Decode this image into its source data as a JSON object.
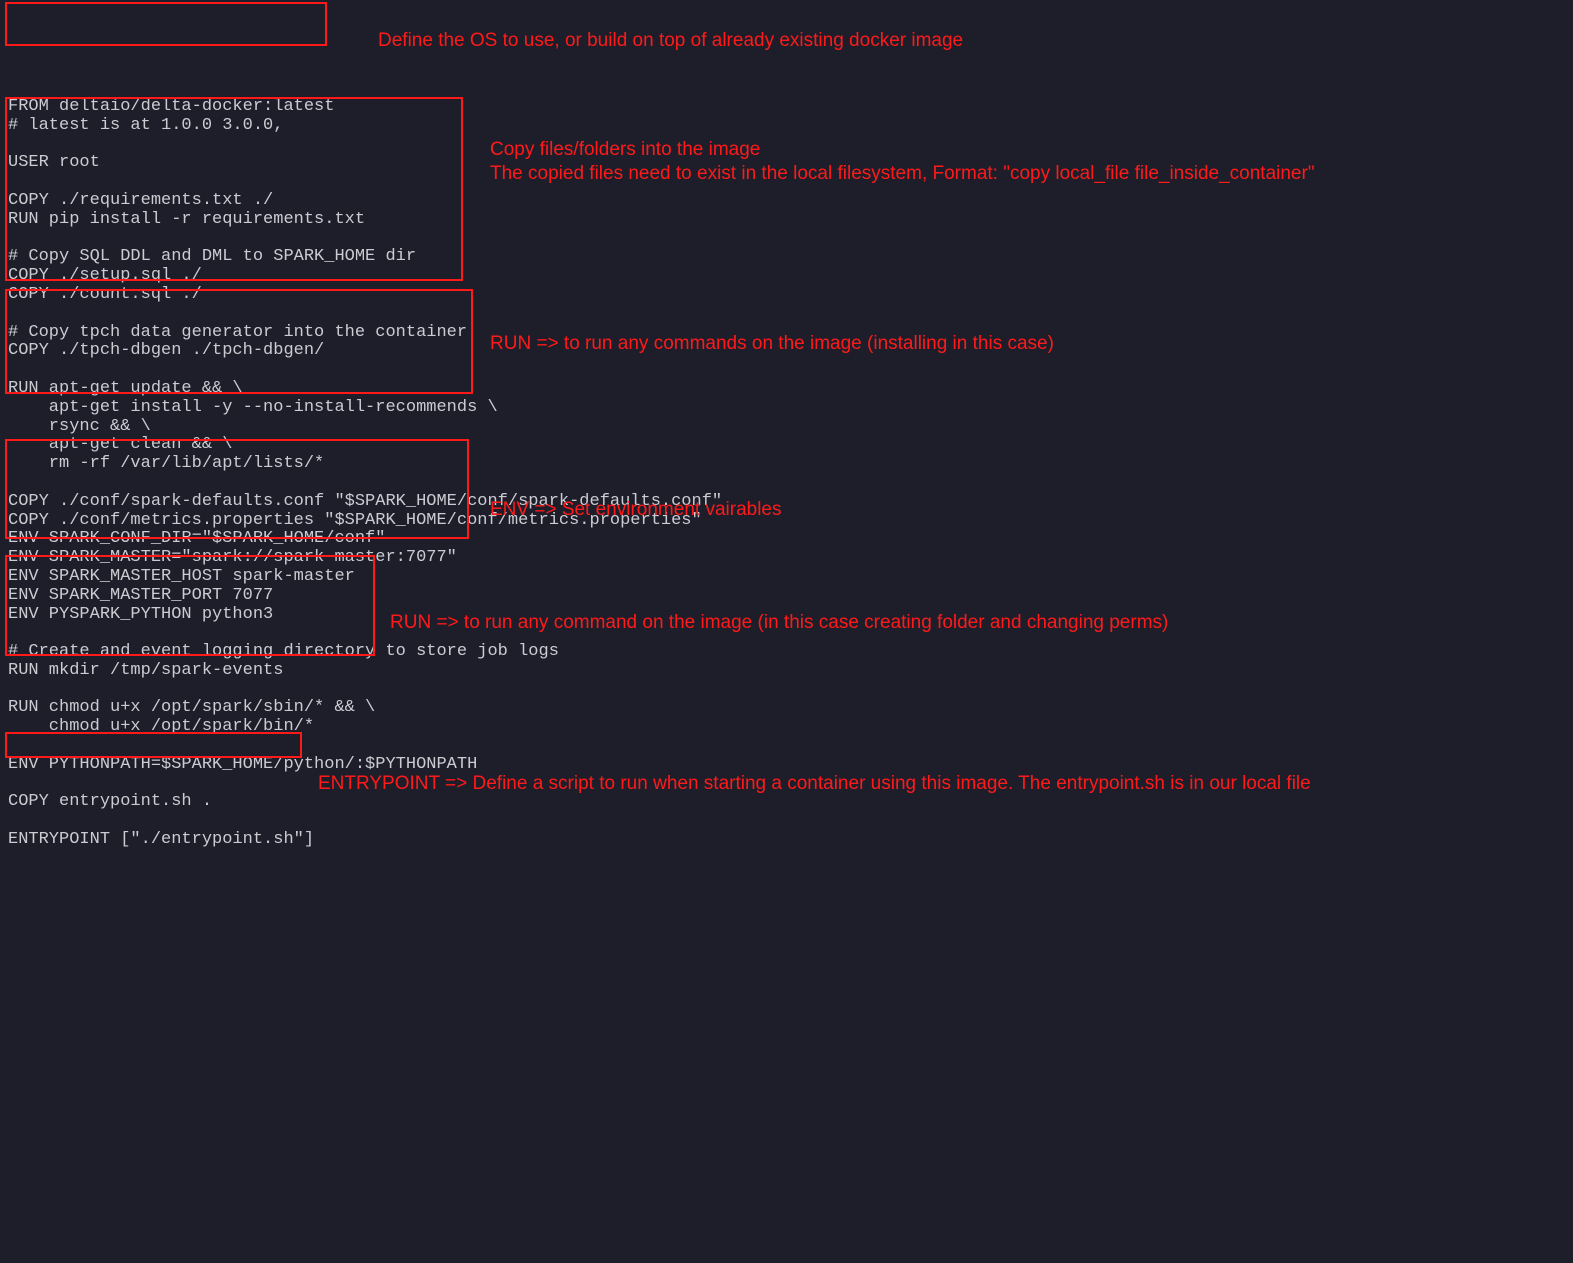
{
  "code": {
    "l1": "FROM deltaio/delta-docker:latest",
    "l2": "# latest is at 1.0.0 3.0.0,",
    "l3": "",
    "l4": "USER root",
    "l5": "",
    "l6": "COPY ./requirements.txt ./",
    "l7": "RUN pip install -r requirements.txt",
    "l8": "",
    "l9": "# Copy SQL DDL and DML to SPARK_HOME dir",
    "l10": "COPY ./setup.sql ./",
    "l11": "COPY ./count.sql ./",
    "l12": "",
    "l13": "# Copy tpch data generator into the container",
    "l14": "COPY ./tpch-dbgen ./tpch-dbgen/",
    "l15": "",
    "l16": "RUN apt-get update && \\",
    "l17": "    apt-get install -y --no-install-recommends \\",
    "l18": "    rsync && \\",
    "l19": "    apt-get clean && \\",
    "l20": "    rm -rf /var/lib/apt/lists/*",
    "l21": "",
    "l22": "COPY ./conf/spark-defaults.conf \"$SPARK_HOME/conf/spark-defaults.conf\"",
    "l23": "COPY ./conf/metrics.properties \"$SPARK_HOME/conf/metrics.properties\"",
    "l24": "ENV SPARK_CONF_DIR=\"$SPARK_HOME/conf\"",
    "l25": "ENV SPARK_MASTER=\"spark://spark-master:7077\"",
    "l26": "ENV SPARK_MASTER_HOST spark-master",
    "l27": "ENV SPARK_MASTER_PORT 7077",
    "l28": "ENV PYSPARK_PYTHON python3",
    "l29": "",
    "l30": "# Create and event logging directory to store job logs",
    "l31": "RUN mkdir /tmp/spark-events",
    "l32": "",
    "l33": "RUN chmod u+x /opt/spark/sbin/* && \\",
    "l34": "    chmod u+x /opt/spark/bin/*",
    "l35": "",
    "l36": "ENV PYTHONPATH=$SPARK_HOME/python/:$PYTHONPATH",
    "l37": "",
    "l38": "COPY entrypoint.sh .",
    "l39": "",
    "l40": "ENTRYPOINT [\"./entrypoint.sh\"]"
  },
  "annotations": {
    "from": "Define the OS to use, or build on top of already existing docker image",
    "copy1": "Copy files/folders into the image",
    "copy2": "The copied files need to exist in the local filesystem, Format: \"copy local_file file_inside_container\"",
    "run1": "RUN => to run any commands on the image (installing in this case)",
    "env": "ENV => Set environment vairables",
    "run2": "RUN => to run any command on the image (in this case creating folder and changing perms)",
    "entry": "ENTRYPOINT => Define a script to run when starting a container using this image. The entrypoint.sh is in our local file"
  }
}
